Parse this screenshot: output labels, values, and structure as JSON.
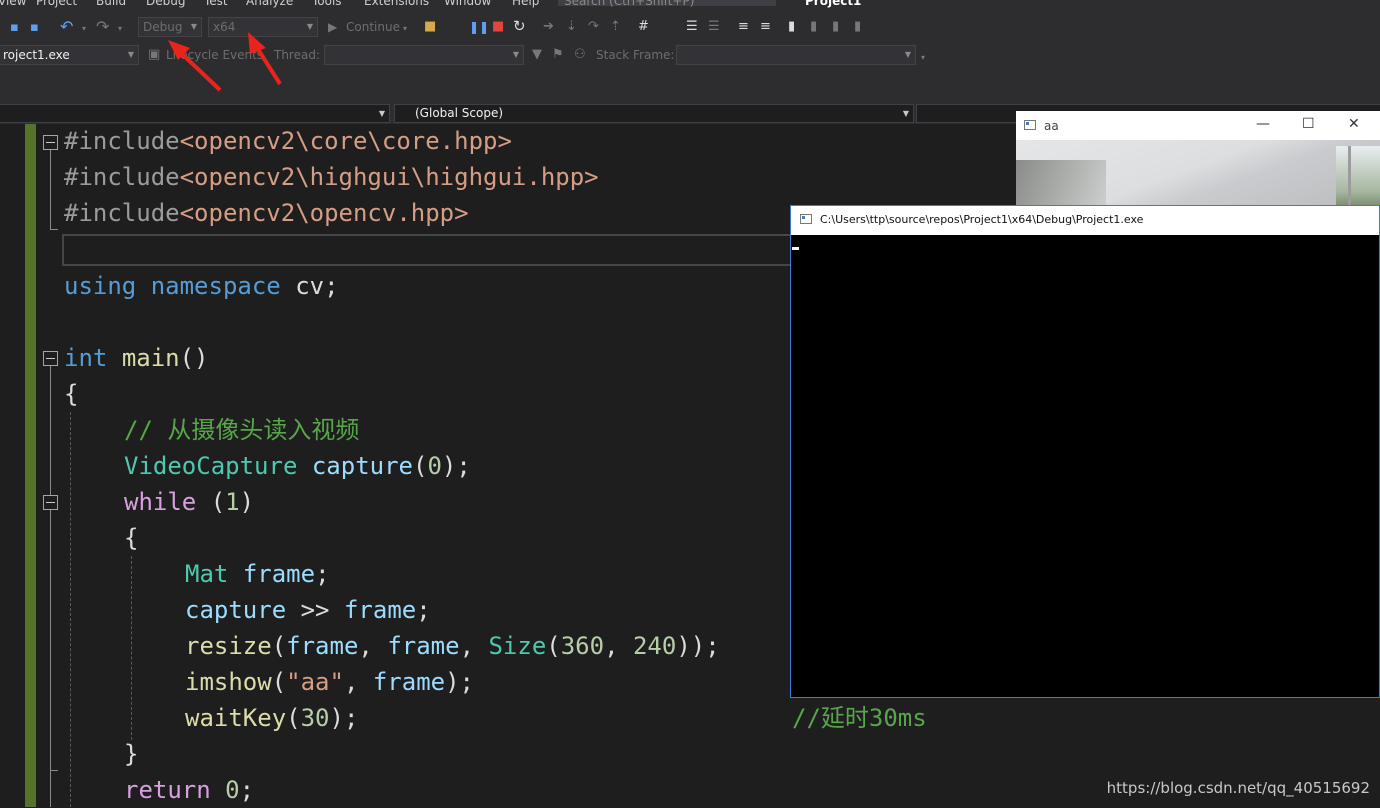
{
  "menu": {
    "items": [
      "View",
      "Project",
      "Build",
      "Debug",
      "Test",
      "Analyze",
      "Tools",
      "Extensions",
      "Window",
      "Help"
    ],
    "search_placeholder": "Search (Ctrl+Shift+P)",
    "solution_name": "Project1"
  },
  "toolbar": {
    "configuration": "Debug",
    "platform": "x64",
    "continue_label": "Continue",
    "process": "roject1.exe",
    "lifecycle_label": "Lifecycle Events",
    "thread_label": "Thread:",
    "thread_value": "",
    "stack_frame_label": "Stack Frame:",
    "stack_frame_value": ""
  },
  "navbar": {
    "left_scope": "",
    "global_scope": "(Global Scope)"
  },
  "code": {
    "line1": {
      "pp": "#include",
      "path": "<opencv2\\core\\core.hpp>"
    },
    "line2": {
      "pp": "#include",
      "path": "<opencv2\\highgui\\highgui.hpp>"
    },
    "line3": {
      "pp": "#include",
      "path": "<opencv2\\opencv.hpp>"
    },
    "line5": {
      "kw1": "using",
      "kw2": "namespace",
      "ns": "cv",
      "end": ";"
    },
    "line7": {
      "kw": "int",
      "fn": "main",
      "paren": "()"
    },
    "line8": "{",
    "line9": "// 从摄像头读入视频",
    "line10": {
      "type": "VideoCapture",
      "var": "capture",
      "open": "(",
      "num": "0",
      "close": ");"
    },
    "line11": {
      "kw": "while",
      "open": "(",
      "num": "1",
      "close": ")"
    },
    "line12": "{",
    "line13": {
      "type": "Mat",
      "var": "frame",
      "end": ";"
    },
    "line14": {
      "var1": "capture",
      "op": ">>",
      "var2": "frame",
      "end": ";"
    },
    "line15": {
      "fn": "resize",
      "open": "(",
      "a1": "frame",
      "sep1": ", ",
      "a2": "frame",
      "sep2": ", ",
      "type": "Size",
      "open2": "(",
      "n1": "360",
      "sep3": ", ",
      "n2": "240",
      "close": "));"
    },
    "line16": {
      "fn": "imshow",
      "open": "(",
      "str": "\"aa\"",
      "sep": ", ",
      "var": "frame",
      "close": ");"
    },
    "line17": {
      "fn": "waitKey",
      "open": "(",
      "num": "30",
      "close": ");",
      "comment": "//延时30ms"
    },
    "line18": "}",
    "line19": {
      "kw": "return",
      "num": "0",
      "end": ";"
    }
  },
  "aa_window": {
    "title": "aa",
    "minimize": "—",
    "maximize": "☐",
    "close": "✕"
  },
  "console_window": {
    "title": "C:\\Users\\ttp\\source\\repos\\Project1\\x64\\Debug\\Project1.exe"
  },
  "watermark": "https://blog.csdn.net/qq_40515692",
  "colors": {
    "annotation_arrow": "#e8241c",
    "margin_green": "#56732c",
    "editor_bg": "#1e1e1e"
  }
}
